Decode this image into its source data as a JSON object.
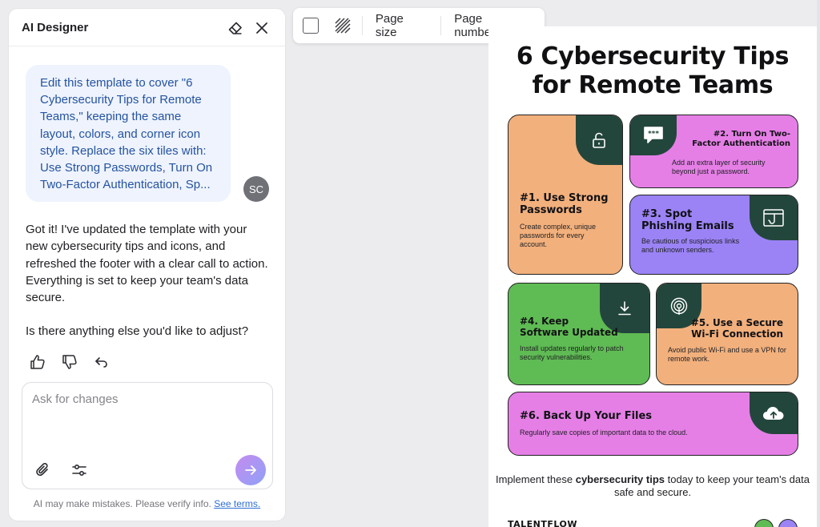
{
  "panel": {
    "title": "AI Designer",
    "user_message": "Edit this template to cover \"6 Cybersecurity Tips for Remote Teams,\" keeping the same layout, colors, and corner icon style. Replace the six tiles with: Use Strong Passwords, Turn On Two-Factor Authentication, Sp...",
    "avatar_initials": "SC",
    "assistant_message_1": "Got it! I've updated the template with your new cybersecurity tips and icons, and refreshed the footer with a clear call to action. Everything is set to keep your team's data secure.",
    "assistant_message_2": "Is there anything else you'd like to adjust?",
    "composer_placeholder": "Ask for changes",
    "disclaimer": "AI may make mistakes. Please verify info.",
    "terms_link": "See terms."
  },
  "toolbar": {
    "page_size": "Page size",
    "page_numbers": "Page numbers"
  },
  "poster": {
    "title_line1": "6 Cybersecurity Tips",
    "title_line2": "for Remote Teams",
    "tiles": [
      {
        "title": "#1. Use Strong Passwords",
        "desc": "Create complex, unique passwords for every account.",
        "color": "#f2b07c",
        "icon": "lock-icon"
      },
      {
        "title": "#2. Turn On Two-Factor Authentication",
        "desc": "Add an extra layer of security beyond just a password.",
        "color": "#e57fe6",
        "icon": "chat-password-icon"
      },
      {
        "title": "#3. Spot Phishing Emails",
        "desc": "Be cautious of suspicious links and unknown senders.",
        "color": "#9b83f6",
        "icon": "phishing-hook-icon"
      },
      {
        "title": "#4. Keep Software Updated",
        "desc": "Install updates regularly to patch security vulnerabilities.",
        "color": "#5fbb54",
        "icon": "download-icon"
      },
      {
        "title": "#5. Use a Secure Wi-Fi Connection",
        "desc": "Avoid public Wi-Fi and use a VPN for remote work.",
        "color": "#f2b07c",
        "icon": "wifi-signal-icon"
      },
      {
        "title": "#6. Back Up Your Files",
        "desc": "Regularly save copies of important data to the cloud.",
        "color": "#e57fe6",
        "icon": "cloud-upload-icon"
      }
    ],
    "footer_pre": "Implement these ",
    "footer_bold": "cybersecurity tips",
    "footer_post": " today to keep your team's data safe and secure.",
    "brand": "TALENTFLOW",
    "corner_color": "#23463c"
  },
  "colors": {
    "user_bubble_bg": "#eef3fd",
    "user_text": "#2553a0",
    "link": "#2f6fd6"
  }
}
